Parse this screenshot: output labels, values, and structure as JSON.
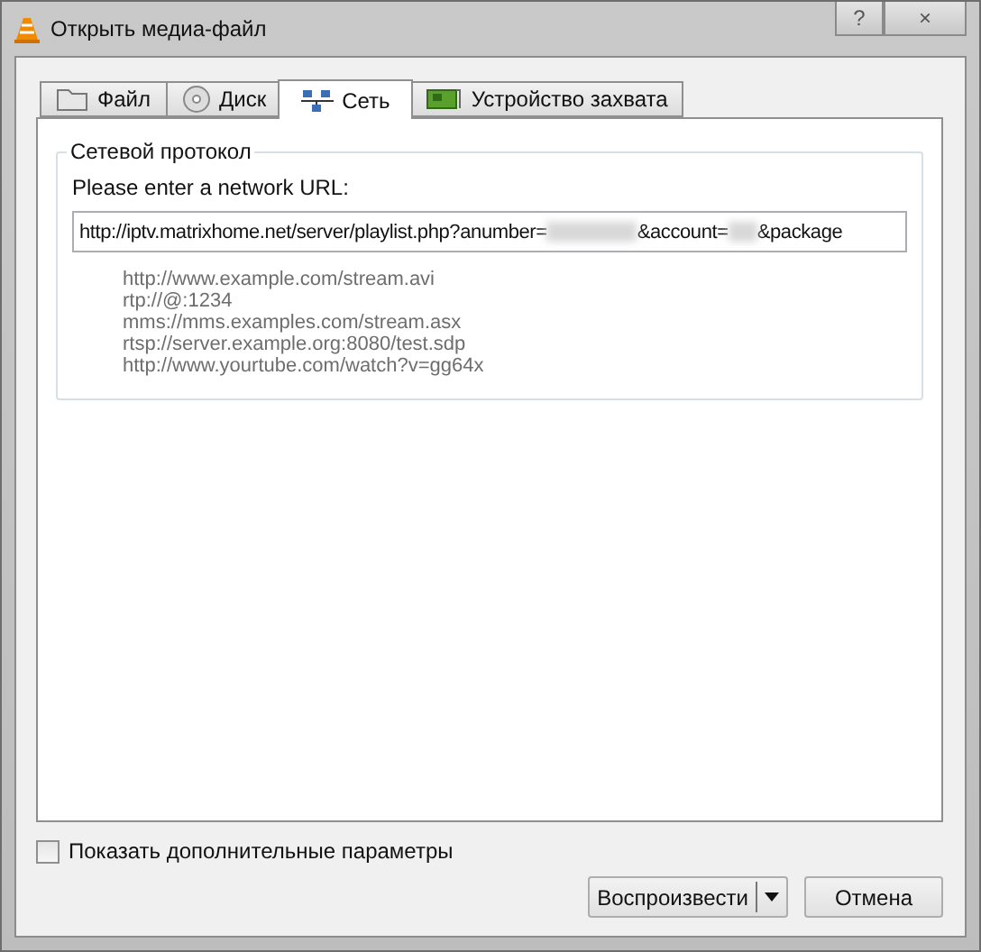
{
  "window": {
    "title": "Открыть медиа-файл",
    "controls": [
      "?",
      "×"
    ]
  },
  "tabs": [
    {
      "label": "Файл",
      "selected": false
    },
    {
      "label": "Диск",
      "selected": false
    },
    {
      "label": "Сеть",
      "selected": true
    },
    {
      "label": "Устройство захвата",
      "selected": false
    }
  ],
  "group": {
    "title": "Сетевой протокол",
    "prompt": "Please enter a network URL:",
    "url": [
      {
        "kind": "text",
        "text": "http://iptv.matrixhome.net/server/playlist.php?anumber="
      },
      {
        "kind": "redacted"
      },
      {
        "kind": "text",
        "text": "&account="
      },
      {
        "kind": "redacted"
      },
      {
        "kind": "text",
        "text": "&package"
      }
    ],
    "examples": [
      "http://www.example.com/stream.avi",
      "rtp://@:1234",
      "mms://mms.examples.com/stream.asx",
      "rtsp://server.example.org:8080/test.sdp",
      "http://www.yourtube.com/watch?v=gg64x"
    ]
  },
  "options_checkbox": {
    "label": "Показать дополнительные параметры",
    "checked": false
  },
  "buttons": [
    {
      "kind": "split",
      "label": "Воспроизвести"
    },
    {
      "kind": "plain",
      "label": "Отмена"
    }
  ]
}
